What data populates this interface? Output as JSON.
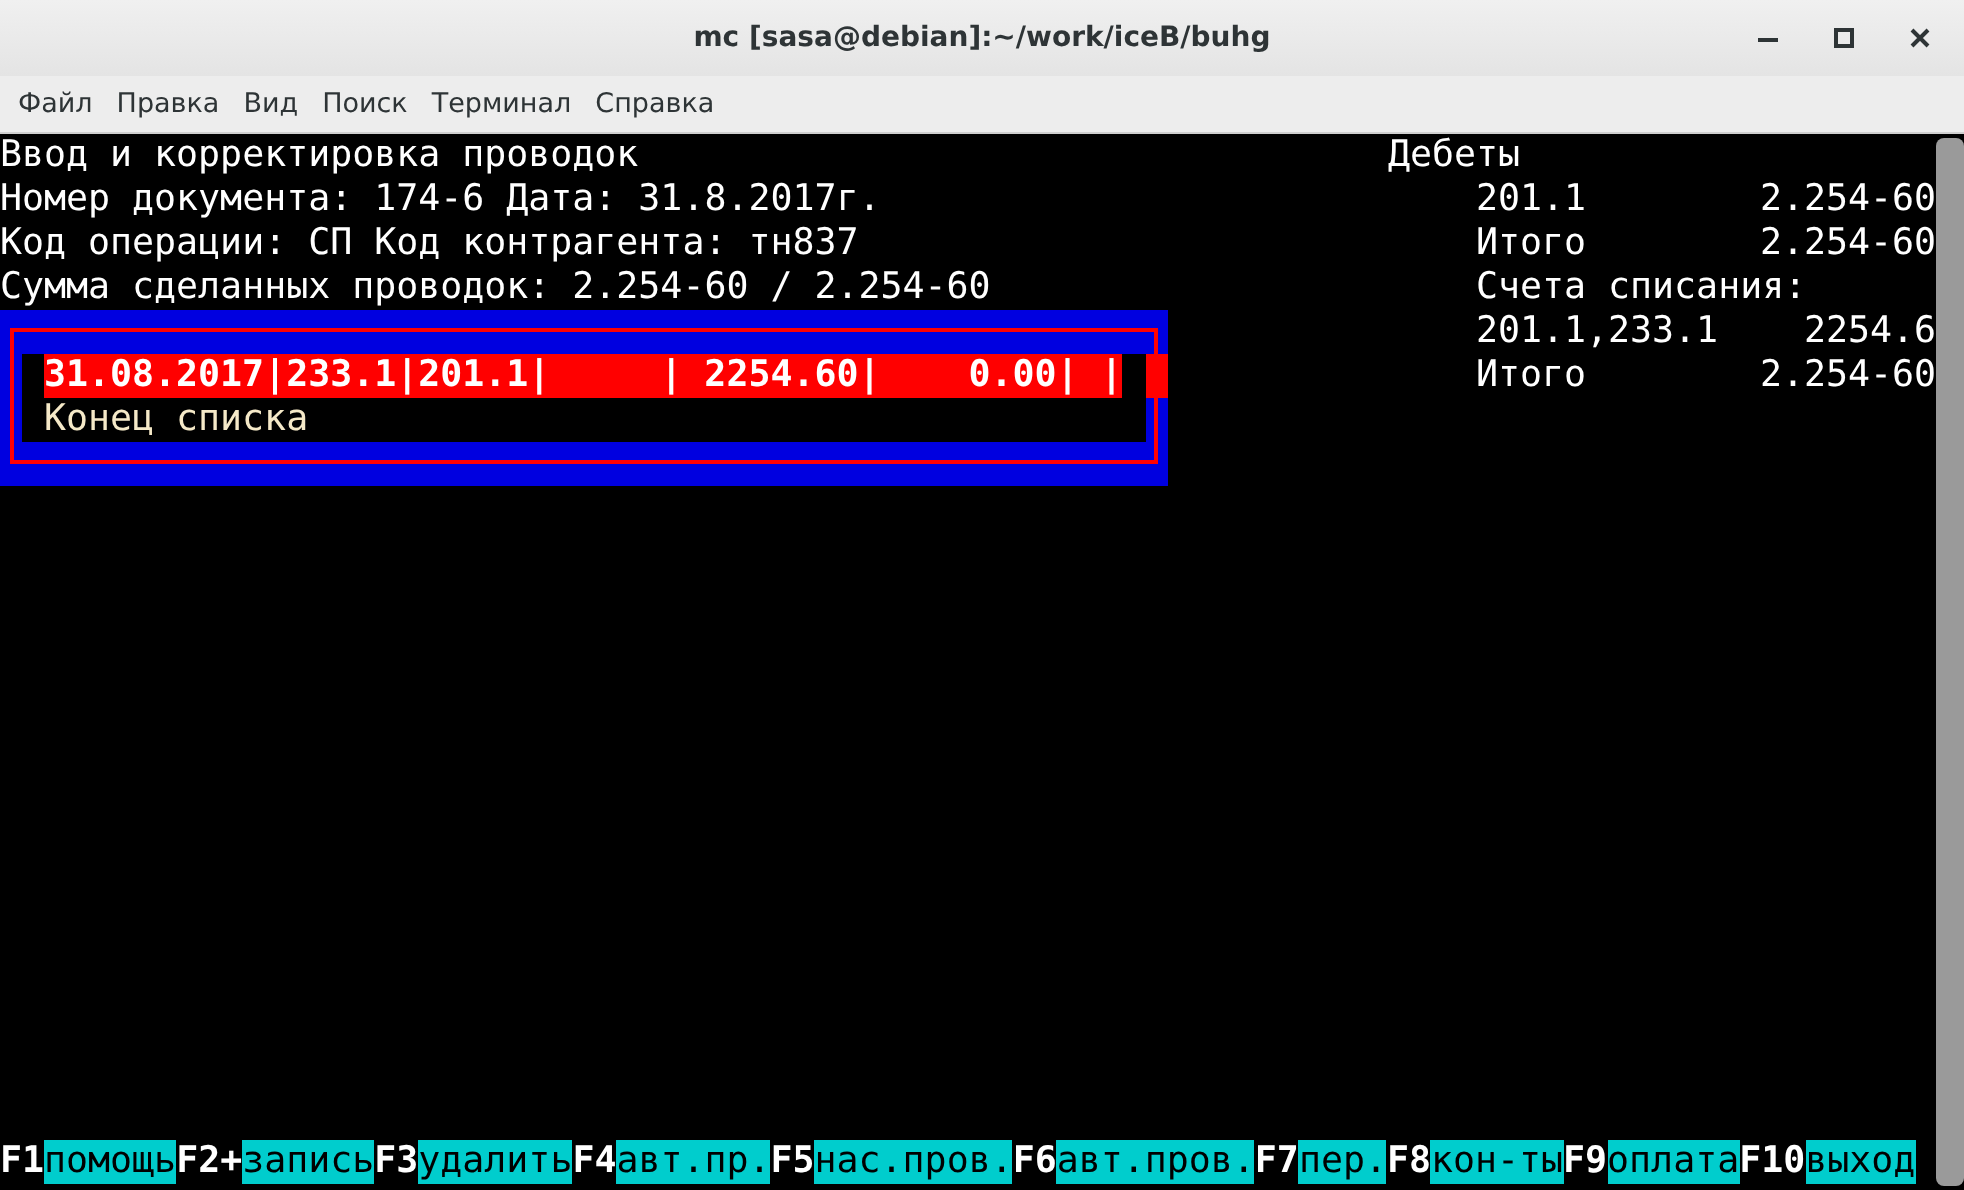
{
  "window": {
    "title": "mc [sasa@debian]:~/work/iceB/buhg"
  },
  "menu": [
    "Файл",
    "Правка",
    "Вид",
    "Поиск",
    "Терминал",
    "Справка"
  ],
  "header_lines": [
    "Ввод и корректировка проводок",
    "Номер документа: 174-6 Дата: 31.8.2017г.",
    "Код операции: СП Код контрагента: тн837",
    "Сумма сделанных проводок: 2.254-60 / 2.254-60"
  ],
  "list": [
    {
      "text": "31.08.2017|233.1|201.1|     | 2254.60|    0.00| |",
      "selected": true
    },
    {
      "text": "Конец списка",
      "selected": false
    }
  ],
  "debits": {
    "heading": "Дебеты",
    "rows": [
      {
        "label": "201.1",
        "value": "2.254-60"
      },
      {
        "label": "Итого",
        "value": "2.254-60"
      },
      {
        "label": "Счета списания:"
      },
      {
        "label": "201.1,233.1",
        "value": "2254.6"
      },
      {
        "label": "Итого",
        "value": "2.254-60"
      }
    ]
  },
  "function_keys": [
    {
      "key": "F1",
      "label": "помощь"
    },
    {
      "key": "F2+",
      "label": "запись"
    },
    {
      "key": "F3",
      "label": "удалить"
    },
    {
      "key": "F4",
      "label": "авт.пр."
    },
    {
      "key": "F5",
      "label": "нас.пров."
    },
    {
      "key": "F6",
      "label": "авт.пров."
    },
    {
      "key": "F7",
      "label": "пер."
    },
    {
      "key": "F8",
      "label": "кон-ты"
    },
    {
      "key": "F9",
      "label": "оплата"
    },
    {
      "key": "F10",
      "label": "выход"
    }
  ]
}
